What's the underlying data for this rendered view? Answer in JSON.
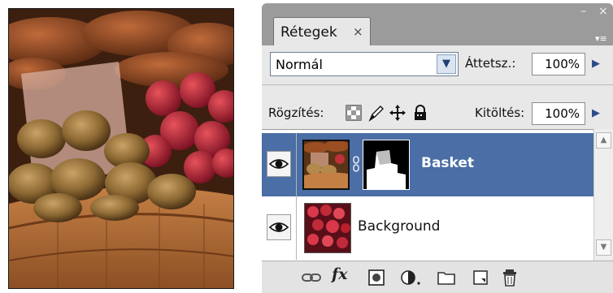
{
  "panel": {
    "tab_label": "Rétegek",
    "close_glyph": "×",
    "window_minimize": "–",
    "window_close": "×",
    "menu_glyph": "▾≡"
  },
  "options": {
    "blend_mode": "Normál",
    "opacity_label": "Áttetsz.:",
    "opacity_value": "100%",
    "lock_label": "Rögzítés:",
    "fill_label": "Kitöltés:",
    "fill_value": "100%",
    "lock_icons": [
      "lock-transparent-pixels-icon",
      "lock-image-pixels-icon",
      "lock-position-icon",
      "lock-all-icon"
    ]
  },
  "layers": [
    {
      "name": "Basket",
      "visible": true,
      "selected": true,
      "has_mask": true,
      "linked_mask": true
    },
    {
      "name": "Background",
      "visible": true,
      "selected": false,
      "has_mask": false
    }
  ],
  "bottom_tools": [
    "link-layers-icon",
    "fx-icon",
    "add-mask-icon",
    "adjustment-layer-icon",
    "new-group-icon",
    "new-layer-icon",
    "delete-layer-icon"
  ],
  "bottom_fx_label": "fx",
  "colors": {
    "selection": "#4a6ea5",
    "panel_bg": "#e8e8e8",
    "header_bg": "#9b9b9b",
    "accent_arrow": "#2a4c8a"
  }
}
